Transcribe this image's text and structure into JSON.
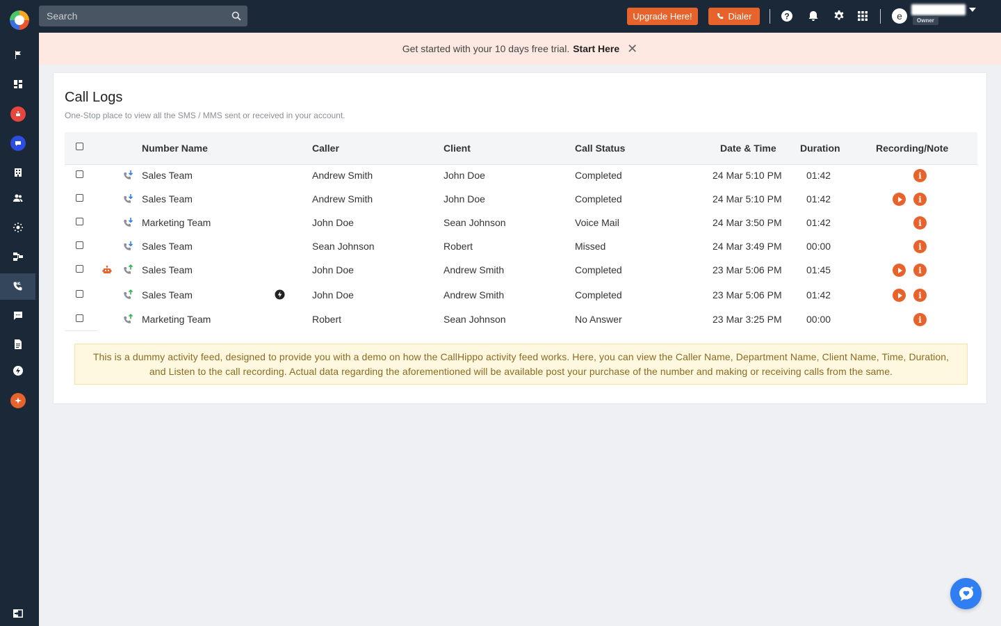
{
  "search": {
    "placeholder": "Search"
  },
  "topbar": {
    "upgrade_label": "Upgrade Here!",
    "dialer_label": "Dialer",
    "avatar_initial": "e",
    "role_badge": "Owner"
  },
  "banner": {
    "text": "Get started with your 10 days free trial.",
    "link": "Start Here",
    "close": "✕"
  },
  "page": {
    "title": "Call Logs",
    "subtitle": "One-Stop place to view all the SMS / MMS sent or received in your account."
  },
  "table": {
    "headers": {
      "number_name": "Number Name",
      "caller": "Caller",
      "client": "Client",
      "call_status": "Call Status",
      "date_time": "Date & Time",
      "duration": "Duration",
      "recording_note": "Recording/Note"
    },
    "rows": [
      {
        "number_name": "Sales Team",
        "caller": "Andrew Smith",
        "client": "John Doe",
        "status": "Completed",
        "datetime": "24 Mar 5:10 PM",
        "duration": "01:42"
      },
      {
        "number_name": "Sales Team",
        "caller": "Andrew Smith",
        "client": "John Doe",
        "status": "Completed",
        "datetime": "24 Mar 5:10 PM",
        "duration": "01:42"
      },
      {
        "number_name": "Marketing Team",
        "caller": "John Doe",
        "client": "Sean Johnson",
        "status": "Voice Mail",
        "datetime": "24 Mar 3:50 PM",
        "duration": "01:42"
      },
      {
        "number_name": "Sales Team",
        "caller": "Sean Johnson",
        "client": "Robert",
        "status": "Missed",
        "datetime": "24 Mar 3:49 PM",
        "duration": "00:00"
      },
      {
        "number_name": "Sales Team",
        "caller": "John Doe",
        "client": "Andrew Smith",
        "status": "Completed",
        "datetime": "23 Mar 5:06 PM",
        "duration": "01:45"
      },
      {
        "number_name": "Sales Team",
        "caller": "John Doe",
        "client": "Andrew Smith",
        "status": "Completed",
        "datetime": "23 Mar 5:06 PM",
        "duration": "01:42"
      },
      {
        "number_name": "Marketing Team",
        "caller": "Robert",
        "client": "Sean Johnson",
        "status": "No Answer",
        "datetime": "23 Mar 3:25 PM",
        "duration": "00:00"
      }
    ]
  },
  "notice": "This is a dummy activity feed, designed to provide you with a demo on how the CallHippo activity feed works. Here, you can view the Caller Name, Department Name, Client Name, Time, Duration, and Listen to the call recording. Actual data regarding the aforementioned will be available post your purchase of the number and making or receiving calls from the same.",
  "colors": {
    "sidebar_bg": "#1b2838",
    "accent_orange": "#e8632c",
    "banner_bg": "#fde8e2",
    "notice_bg": "#fff8e1",
    "notice_text": "#8a6a1f",
    "incoming_arrow": "#2f7ef2",
    "outgoing_arrow": "#2db84d",
    "fab_blue": "#2f7ef2"
  }
}
